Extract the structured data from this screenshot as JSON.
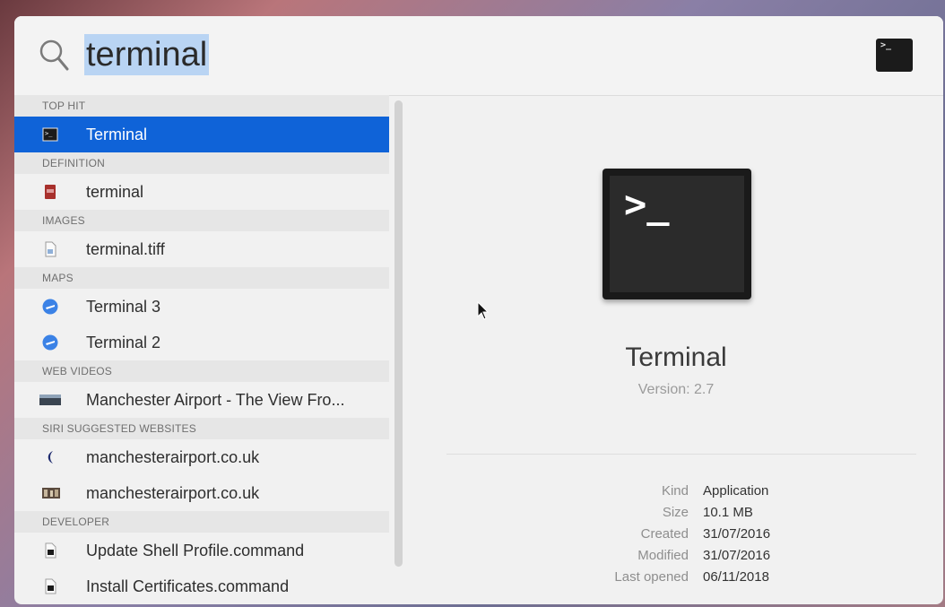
{
  "search": {
    "query": "terminal"
  },
  "sections": [
    {
      "header": "TOP HIT",
      "items": [
        {
          "label": "Terminal",
          "icon": "terminal-icon",
          "selected": true
        }
      ]
    },
    {
      "header": "DEFINITION",
      "items": [
        {
          "label": "terminal",
          "icon": "dictionary-icon"
        }
      ]
    },
    {
      "header": "IMAGES",
      "items": [
        {
          "label": "terminal.tiff",
          "icon": "image-file-icon"
        }
      ]
    },
    {
      "header": "MAPS",
      "items": [
        {
          "label": "Terminal 3",
          "icon": "airport-icon"
        },
        {
          "label": "Terminal 2",
          "icon": "airport-icon"
        }
      ]
    },
    {
      "header": "WEB VIDEOS",
      "items": [
        {
          "label": "Manchester Airport - The View Fro...",
          "icon": "video-thumbnail-icon"
        }
      ]
    },
    {
      "header": "SIRI SUGGESTED WEBSITES",
      "items": [
        {
          "label": "manchesterairport.co.uk",
          "icon": "site-favicon-icon"
        },
        {
          "label": "manchesterairport.co.uk",
          "icon": "site-thumbnail-icon"
        }
      ]
    },
    {
      "header": "DEVELOPER",
      "items": [
        {
          "label": "Update Shell Profile.command",
          "icon": "command-file-icon"
        },
        {
          "label": "Install Certificates.command",
          "icon": "command-file-icon"
        }
      ]
    }
  ],
  "preview": {
    "title": "Terminal",
    "version": "Version: 2.7",
    "meta": [
      {
        "key": "Kind",
        "value": "Application"
      },
      {
        "key": "Size",
        "value": "10.1 MB"
      },
      {
        "key": "Created",
        "value": "31/07/2016"
      },
      {
        "key": "Modified",
        "value": "31/07/2016"
      },
      {
        "key": "Last opened",
        "value": "06/11/2018"
      }
    ]
  },
  "colors": {
    "selection": "#0f63d8",
    "query_highlight": "#b9d4f3"
  }
}
